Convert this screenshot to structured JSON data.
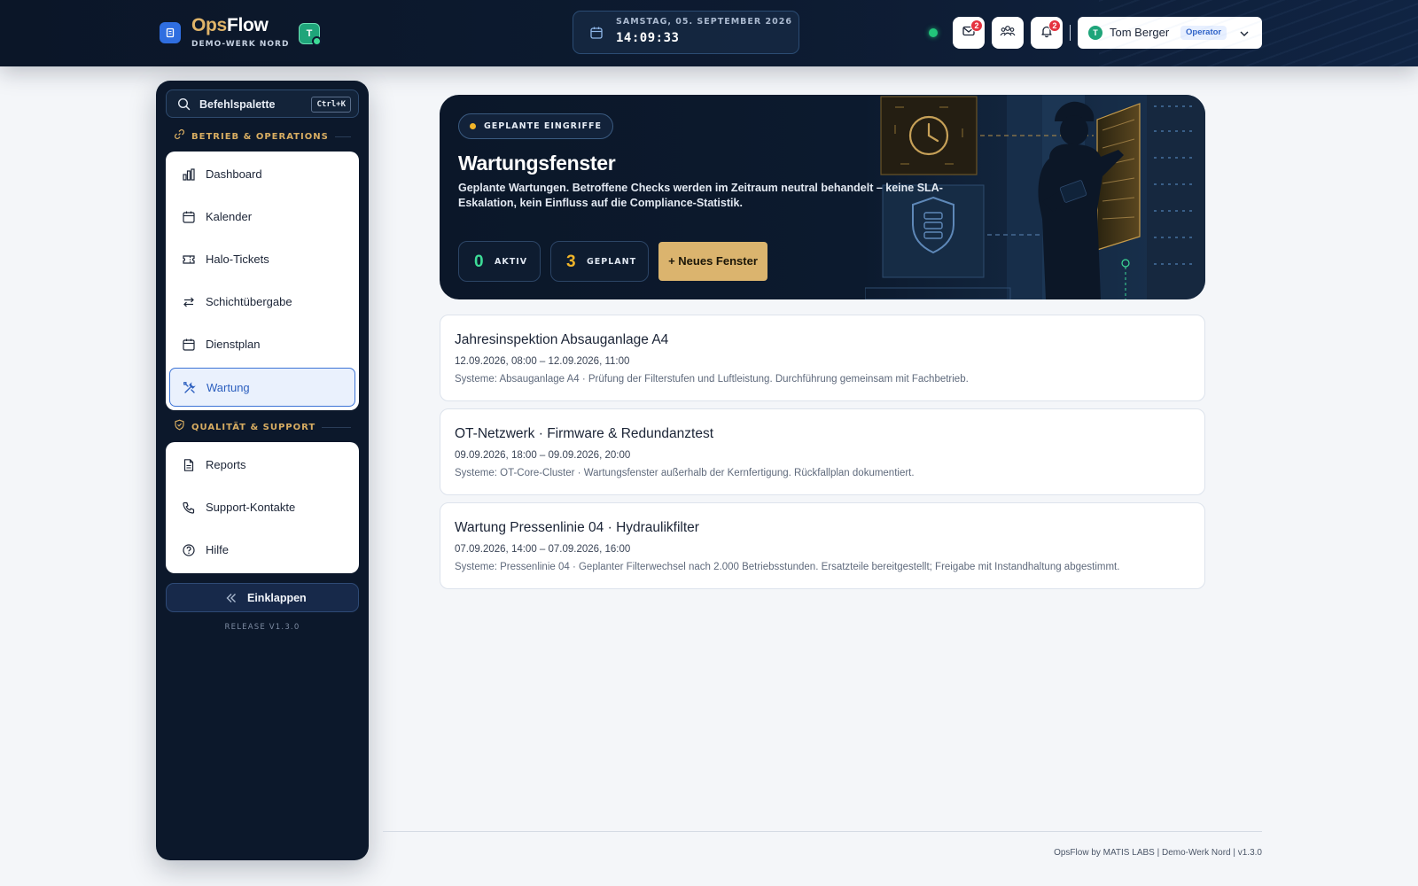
{
  "header": {
    "brand_part1": "Ops",
    "brand_part2": "Flow",
    "site": "DEMO-WERK NORD",
    "tenant_initial": "T",
    "date": "SAMSTAG, 05. SEPTEMBER 2026",
    "time": "14:09:33",
    "status_color": "#22c47a",
    "messages_count": "2",
    "notifications_count": "2",
    "user": {
      "initial": "T",
      "name": "Tom Berger",
      "role": "Operator"
    }
  },
  "sidebar": {
    "search_label": "Befehlspalette",
    "search_shortcut": "Ctrl+K",
    "sections": [
      {
        "title": "BETRIEB & OPERATIONS",
        "items": [
          {
            "label": "Dashboard",
            "icon": "dashboard-icon"
          },
          {
            "label": "Kalender",
            "icon": "calendar-icon"
          },
          {
            "label": "Halo-Tickets",
            "icon": "ticket-icon"
          },
          {
            "label": "Schichtübergabe",
            "icon": "swap-icon"
          },
          {
            "label": "Dienstplan",
            "icon": "calendar-icon"
          },
          {
            "label": "Wartung",
            "icon": "tools-icon",
            "active": true
          }
        ]
      },
      {
        "title": "QUALITÄT & SUPPORT",
        "items": [
          {
            "label": "Reports",
            "icon": "document-icon"
          },
          {
            "label": "Support-Kontakte",
            "icon": "phone-icon"
          },
          {
            "label": "Hilfe",
            "icon": "help-icon"
          }
        ]
      }
    ],
    "collapse_label": "Einklappen",
    "release": "RELEASE V1.3.0"
  },
  "hero": {
    "pill": "GEPLANTE EINGRIFFE",
    "title": "Wartungsfenster",
    "description": "Geplante Wartungen. Betroffene Checks werden im Zeitraum neutral behandelt – keine SLA-Eskalation, kein Einfluss auf die Compliance-Statistik.",
    "active_count": "0",
    "active_label": "AKTIV",
    "planned_count": "3",
    "planned_label": "GEPLANT",
    "new_button": "+ Neues Fenster",
    "accent_active": "#3ddc97",
    "accent_planned": "#f0b429"
  },
  "maintenance": [
    {
      "title": "Jahresinspektion Absauganlage A4",
      "time": "12.09.2026, 08:00 – 12.09.2026, 11:00",
      "details": "Systeme: Absauganlage A4 · Prüfung der Filterstufen und Luftleistung. Durchführung gemeinsam mit Fachbetrieb."
    },
    {
      "title": "OT-Netzwerk · Firmware & Redundanztest",
      "time": "09.09.2026, 18:00 – 09.09.2026, 20:00",
      "details": "Systeme: OT-Core-Cluster · Wartungsfenster außerhalb der Kernfertigung. Rückfallplan dokumentiert."
    },
    {
      "title": "Wartung Pressenlinie 04 · Hydraulikfilter",
      "time": "07.09.2026, 14:00 – 07.09.2026, 16:00",
      "details": "Systeme: Pressenlinie 04 · Geplanter Filterwechsel nach 2.000 Betriebsstunden. Ersatzteile bereitgestellt; Freigabe mit Instandhaltung abgestimmt."
    }
  ],
  "footer": {
    "text": "OpsFlow by MATIS LABS | Demo-Werk Nord | v1.3.0"
  }
}
